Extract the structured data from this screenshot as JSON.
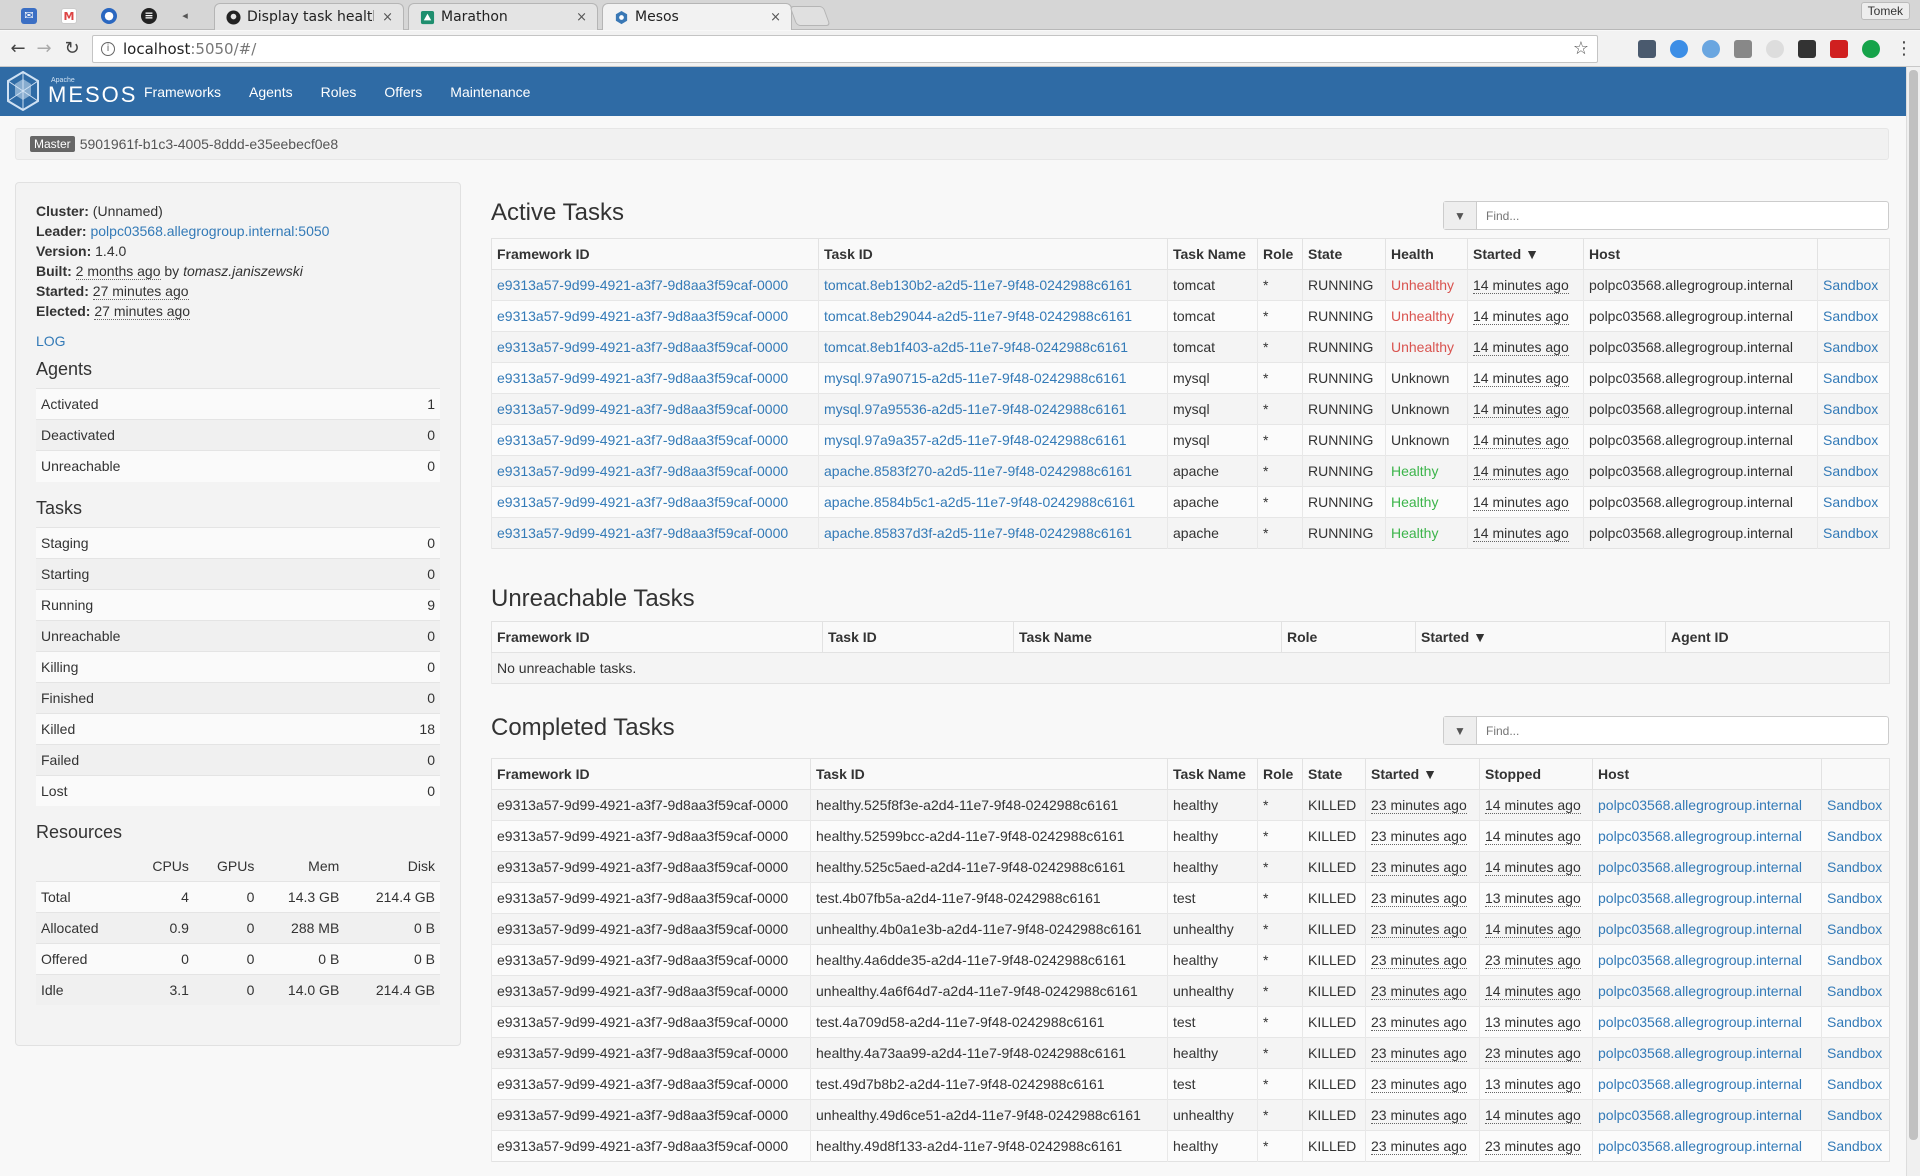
{
  "browser": {
    "tabs": [
      {
        "title": "Display task health",
        "favicon": "github-icon",
        "close": "×"
      },
      {
        "title": "Marathon",
        "favicon": "marathon-icon",
        "close": "×"
      },
      {
        "title": "Mesos",
        "favicon": "mesos-icon",
        "close": "×"
      }
    ],
    "profile": "Tomek",
    "url_host": "localhost",
    "url_path": ":5050/#/"
  },
  "navbar": {
    "brand_small": "Apache",
    "brand": "MESOS",
    "links": [
      "Frameworks",
      "Agents",
      "Roles",
      "Offers",
      "Maintenance"
    ]
  },
  "master": {
    "badge": "Master",
    "id": "5901961f-b1c3-4005-8ddd-e35eebecf0e8"
  },
  "cluster": {
    "cluster_label": "Cluster:",
    "cluster": "(Unnamed)",
    "leader_label": "Leader:",
    "leader": "polpc03568.allegrogroup.internal:5050",
    "version_label": "Version:",
    "version": "1.4.0",
    "built_label": "Built:",
    "built": "2 months ago",
    "built_by": "by",
    "built_author": "tomasz.janiszewski",
    "started_label": "Started:",
    "started": "27 minutes ago",
    "elected_label": "Elected:",
    "elected": "27 minutes ago",
    "log": "LOG"
  },
  "agents": {
    "title": "Agents",
    "rows": [
      {
        "label": "Activated",
        "value": "1"
      },
      {
        "label": "Deactivated",
        "value": "0"
      },
      {
        "label": "Unreachable",
        "value": "0"
      }
    ]
  },
  "tasks": {
    "title": "Tasks",
    "rows": [
      {
        "label": "Staging",
        "value": "0"
      },
      {
        "label": "Starting",
        "value": "0"
      },
      {
        "label": "Running",
        "value": "9"
      },
      {
        "label": "Unreachable",
        "value": "0"
      },
      {
        "label": "Killing",
        "value": "0"
      },
      {
        "label": "Finished",
        "value": "0"
      },
      {
        "label": "Killed",
        "value": "18"
      },
      {
        "label": "Failed",
        "value": "0"
      },
      {
        "label": "Lost",
        "value": "0"
      }
    ]
  },
  "resources": {
    "title": "Resources",
    "columns": [
      "CPUs",
      "GPUs",
      "Mem",
      "Disk"
    ],
    "rows": [
      {
        "label": "Total",
        "cpus": "4",
        "gpus": "0",
        "mem": "14.3 GB",
        "disk": "214.4 GB"
      },
      {
        "label": "Allocated",
        "cpus": "0.9",
        "gpus": "0",
        "mem": "288 MB",
        "disk": "0 B"
      },
      {
        "label": "Offered",
        "cpus": "0",
        "gpus": "0",
        "mem": "0 B",
        "disk": "0 B"
      },
      {
        "label": "Idle",
        "cpus": "3.1",
        "gpus": "0",
        "mem": "14.0 GB",
        "disk": "214.4 GB"
      }
    ]
  },
  "active": {
    "title": "Active Tasks",
    "find_placeholder": "Find...",
    "columns": [
      "Framework ID",
      "Task ID",
      "Task Name",
      "Role",
      "State",
      "Health",
      "Started ▼",
      "Host",
      ""
    ],
    "rows": [
      {
        "fw": "e9313a57-9d99-4921-a3f7-9d8aa3f59caf-0000",
        "id": "tomcat.8eb130b2-a2d5-11e7-9f48-0242988c6161",
        "name": "tomcat",
        "role": "*",
        "state": "RUNNING",
        "health": "Unhealthy",
        "started": "14 minutes ago",
        "host": "polpc03568.allegrogroup.internal",
        "sandbox": "Sandbox"
      },
      {
        "fw": "e9313a57-9d99-4921-a3f7-9d8aa3f59caf-0000",
        "id": "tomcat.8eb29044-a2d5-11e7-9f48-0242988c6161",
        "name": "tomcat",
        "role": "*",
        "state": "RUNNING",
        "health": "Unhealthy",
        "started": "14 minutes ago",
        "host": "polpc03568.allegrogroup.internal",
        "sandbox": "Sandbox"
      },
      {
        "fw": "e9313a57-9d99-4921-a3f7-9d8aa3f59caf-0000",
        "id": "tomcat.8eb1f403-a2d5-11e7-9f48-0242988c6161",
        "name": "tomcat",
        "role": "*",
        "state": "RUNNING",
        "health": "Unhealthy",
        "started": "14 minutes ago",
        "host": "polpc03568.allegrogroup.internal",
        "sandbox": "Sandbox"
      },
      {
        "fw": "e9313a57-9d99-4921-a3f7-9d8aa3f59caf-0000",
        "id": "mysql.97a90715-a2d5-11e7-9f48-0242988c6161",
        "name": "mysql",
        "role": "*",
        "state": "RUNNING",
        "health": "Unknown",
        "started": "14 minutes ago",
        "host": "polpc03568.allegrogroup.internal",
        "sandbox": "Sandbox"
      },
      {
        "fw": "e9313a57-9d99-4921-a3f7-9d8aa3f59caf-0000",
        "id": "mysql.97a95536-a2d5-11e7-9f48-0242988c6161",
        "name": "mysql",
        "role": "*",
        "state": "RUNNING",
        "health": "Unknown",
        "started": "14 minutes ago",
        "host": "polpc03568.allegrogroup.internal",
        "sandbox": "Sandbox"
      },
      {
        "fw": "e9313a57-9d99-4921-a3f7-9d8aa3f59caf-0000",
        "id": "mysql.97a9a357-a2d5-11e7-9f48-0242988c6161",
        "name": "mysql",
        "role": "*",
        "state": "RUNNING",
        "health": "Unknown",
        "started": "14 minutes ago",
        "host": "polpc03568.allegrogroup.internal",
        "sandbox": "Sandbox"
      },
      {
        "fw": "e9313a57-9d99-4921-a3f7-9d8aa3f59caf-0000",
        "id": "apache.8583f270-a2d5-11e7-9f48-0242988c6161",
        "name": "apache",
        "role": "*",
        "state": "RUNNING",
        "health": "Healthy",
        "started": "14 minutes ago",
        "host": "polpc03568.allegrogroup.internal",
        "sandbox": "Sandbox"
      },
      {
        "fw": "e9313a57-9d99-4921-a3f7-9d8aa3f59caf-0000",
        "id": "apache.8584b5c1-a2d5-11e7-9f48-0242988c6161",
        "name": "apache",
        "role": "*",
        "state": "RUNNING",
        "health": "Healthy",
        "started": "14 minutes ago",
        "host": "polpc03568.allegrogroup.internal",
        "sandbox": "Sandbox"
      },
      {
        "fw": "e9313a57-9d99-4921-a3f7-9d8aa3f59caf-0000",
        "id": "apache.85837d3f-a2d5-11e7-9f48-0242988c6161",
        "name": "apache",
        "role": "*",
        "state": "RUNNING",
        "health": "Healthy",
        "started": "14 minutes ago",
        "host": "polpc03568.allegrogroup.internal",
        "sandbox": "Sandbox"
      }
    ]
  },
  "unreachable": {
    "title": "Unreachable Tasks",
    "columns": [
      "Framework ID",
      "Task ID",
      "Task Name",
      "Role",
      "Started ▼",
      "Agent ID"
    ],
    "empty": "No unreachable tasks."
  },
  "completed": {
    "title": "Completed Tasks",
    "find_placeholder": "Find...",
    "columns": [
      "Framework ID",
      "Task ID",
      "Task Name",
      "Role",
      "State",
      "Started ▼",
      "Stopped",
      "Host",
      ""
    ],
    "rows": [
      {
        "fw": "e9313a57-9d99-4921-a3f7-9d8aa3f59caf-0000",
        "id": "healthy.525f8f3e-a2d4-11e7-9f48-0242988c6161",
        "name": "healthy",
        "role": "*",
        "state": "KILLED",
        "started": "23 minutes ago",
        "stopped": "14 minutes ago",
        "host": "polpc03568.allegrogroup.internal",
        "sandbox": "Sandbox"
      },
      {
        "fw": "e9313a57-9d99-4921-a3f7-9d8aa3f59caf-0000",
        "id": "healthy.52599bcc-a2d4-11e7-9f48-0242988c6161",
        "name": "healthy",
        "role": "*",
        "state": "KILLED",
        "started": "23 minutes ago",
        "stopped": "14 minutes ago",
        "host": "polpc03568.allegrogroup.internal",
        "sandbox": "Sandbox"
      },
      {
        "fw": "e9313a57-9d99-4921-a3f7-9d8aa3f59caf-0000",
        "id": "healthy.525c5aed-a2d4-11e7-9f48-0242988c6161",
        "name": "healthy",
        "role": "*",
        "state": "KILLED",
        "started": "23 minutes ago",
        "stopped": "14 minutes ago",
        "host": "polpc03568.allegrogroup.internal",
        "sandbox": "Sandbox"
      },
      {
        "fw": "e9313a57-9d99-4921-a3f7-9d8aa3f59caf-0000",
        "id": "test.4b07fb5a-a2d4-11e7-9f48-0242988c6161",
        "name": "test",
        "role": "*",
        "state": "KILLED",
        "started": "23 minutes ago",
        "stopped": "13 minutes ago",
        "host": "polpc03568.allegrogroup.internal",
        "sandbox": "Sandbox"
      },
      {
        "fw": "e9313a57-9d99-4921-a3f7-9d8aa3f59caf-0000",
        "id": "unhealthy.4b0a1e3b-a2d4-11e7-9f48-0242988c6161",
        "name": "unhealthy",
        "role": "*",
        "state": "KILLED",
        "started": "23 minutes ago",
        "stopped": "14 minutes ago",
        "host": "polpc03568.allegrogroup.internal",
        "sandbox": "Sandbox"
      },
      {
        "fw": "e9313a57-9d99-4921-a3f7-9d8aa3f59caf-0000",
        "id": "healthy.4a6dde35-a2d4-11e7-9f48-0242988c6161",
        "name": "healthy",
        "role": "*",
        "state": "KILLED",
        "started": "23 minutes ago",
        "stopped": "23 minutes ago",
        "host": "polpc03568.allegrogroup.internal",
        "sandbox": "Sandbox"
      },
      {
        "fw": "e9313a57-9d99-4921-a3f7-9d8aa3f59caf-0000",
        "id": "unhealthy.4a6f64d7-a2d4-11e7-9f48-0242988c6161",
        "name": "unhealthy",
        "role": "*",
        "state": "KILLED",
        "started": "23 minutes ago",
        "stopped": "14 minutes ago",
        "host": "polpc03568.allegrogroup.internal",
        "sandbox": "Sandbox"
      },
      {
        "fw": "e9313a57-9d99-4921-a3f7-9d8aa3f59caf-0000",
        "id": "test.4a709d58-a2d4-11e7-9f48-0242988c6161",
        "name": "test",
        "role": "*",
        "state": "KILLED",
        "started": "23 minutes ago",
        "stopped": "13 minutes ago",
        "host": "polpc03568.allegrogroup.internal",
        "sandbox": "Sandbox"
      },
      {
        "fw": "e9313a57-9d99-4921-a3f7-9d8aa3f59caf-0000",
        "id": "healthy.4a73aa99-a2d4-11e7-9f48-0242988c6161",
        "name": "healthy",
        "role": "*",
        "state": "KILLED",
        "started": "23 minutes ago",
        "stopped": "23 minutes ago",
        "host": "polpc03568.allegrogroup.internal",
        "sandbox": "Sandbox"
      },
      {
        "fw": "e9313a57-9d99-4921-a3f7-9d8aa3f59caf-0000",
        "id": "test.49d7b8b2-a2d4-11e7-9f48-0242988c6161",
        "name": "test",
        "role": "*",
        "state": "KILLED",
        "started": "23 minutes ago",
        "stopped": "13 minutes ago",
        "host": "polpc03568.allegrogroup.internal",
        "sandbox": "Sandbox"
      },
      {
        "fw": "e9313a57-9d99-4921-a3f7-9d8aa3f59caf-0000",
        "id": "unhealthy.49d6ce51-a2d4-11e7-9f48-0242988c6161",
        "name": "unhealthy",
        "role": "*",
        "state": "KILLED",
        "started": "23 minutes ago",
        "stopped": "14 minutes ago",
        "host": "polpc03568.allegrogroup.internal",
        "sandbox": "Sandbox"
      },
      {
        "fw": "e9313a57-9d99-4921-a3f7-9d8aa3f59caf-0000",
        "id": "healthy.49d8f133-a2d4-11e7-9f48-0242988c6161",
        "name": "healthy",
        "role": "*",
        "state": "KILLED",
        "started": "23 minutes ago",
        "stopped": "23 minutes ago",
        "host": "polpc03568.allegrogroup.internal",
        "sandbox": "Sandbox"
      }
    ]
  },
  "colors": {
    "navbar": "#2f6ba5",
    "link": "#337ab7",
    "unhealthy": "#d9534f",
    "healthy": "#3bb44a"
  }
}
